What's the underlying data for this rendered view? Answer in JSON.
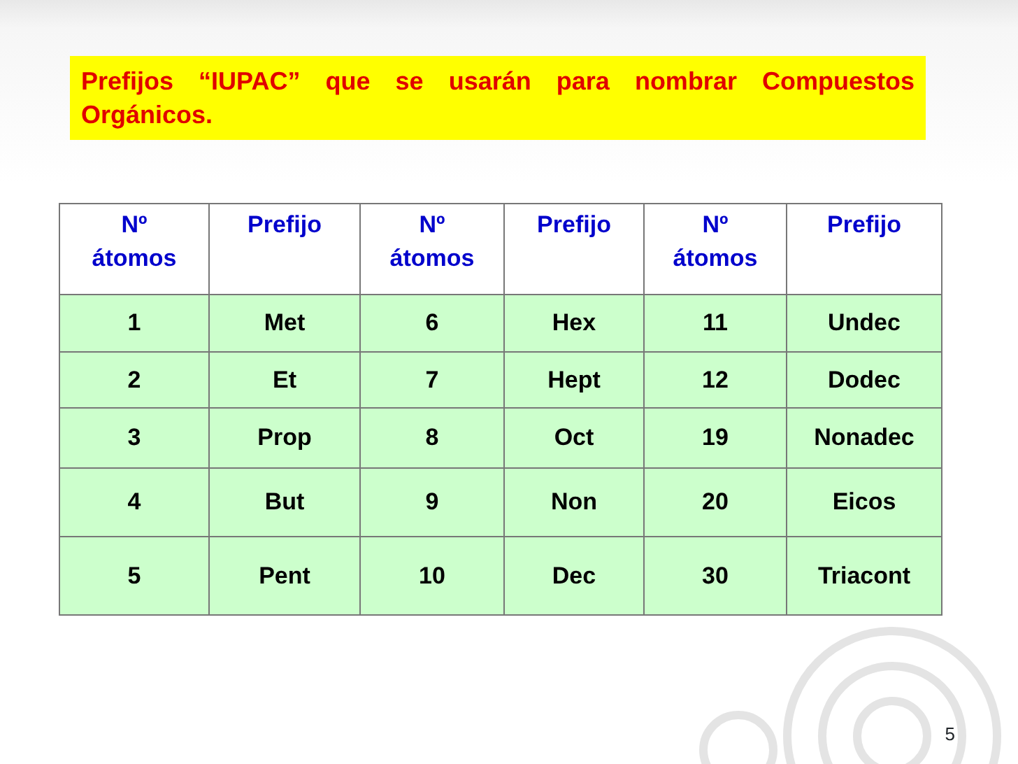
{
  "title": "Prefijos “IUPAC” que se usarán para nombrar Compuestos Orgánicos.",
  "table": {
    "columns": [
      "Nº átomos",
      "Prefijo",
      "Nº átomos",
      "Prefijo",
      "Nº átomos",
      "Prefijo"
    ],
    "rows": [
      [
        "1",
        "Met",
        "6",
        "Hex",
        "11",
        "Undec"
      ],
      [
        "2",
        "Et",
        "7",
        "Hept",
        "12",
        "Dodec"
      ],
      [
        "3",
        "Prop",
        "8",
        "Oct",
        "19",
        "Nonadec"
      ],
      [
        "4",
        "But",
        "9",
        "Non",
        "20",
        "Eicos"
      ],
      [
        "5",
        "Pent",
        "10",
        "Dec",
        "30",
        "Triacont"
      ]
    ]
  },
  "page_number": "5"
}
